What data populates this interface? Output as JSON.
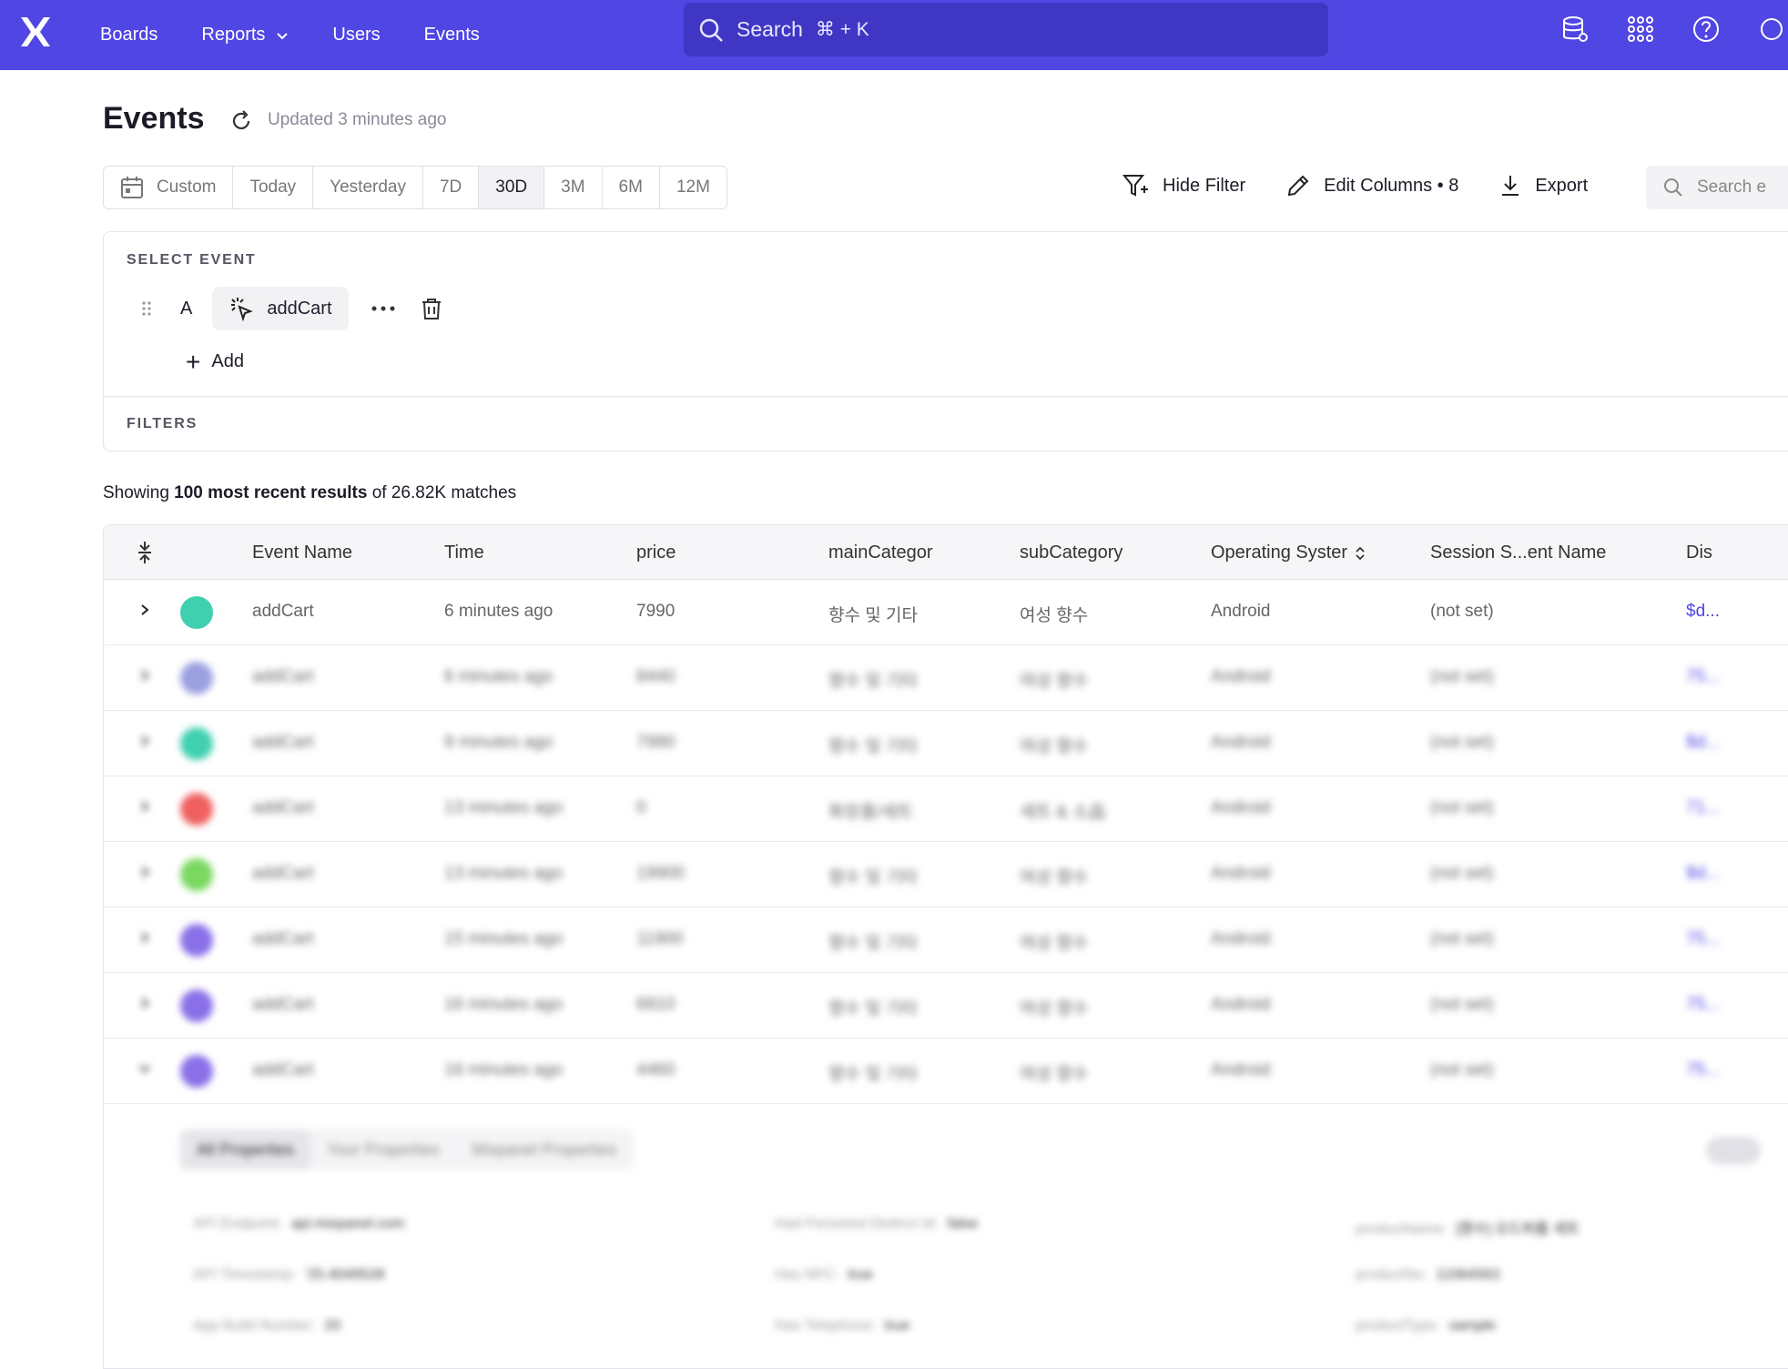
{
  "nav": {
    "links": [
      "Boards",
      "Reports",
      "Users",
      "Events"
    ],
    "search_label": "Search",
    "search_shortcut": "⌘ + K",
    "brand_color": "#5046e4"
  },
  "header": {
    "title": "Events",
    "updated": "Updated 3 minutes ago"
  },
  "date_range": {
    "options": [
      "Custom",
      "Today",
      "Yesterday",
      "7D",
      "30D",
      "3M",
      "6M",
      "12M"
    ],
    "selected": "30D"
  },
  "actions": {
    "hide_filter": "Hide Filter",
    "edit_columns": "Edit Columns • 8",
    "export": "Export",
    "search_placeholder": "Search e"
  },
  "select_event": {
    "label": "SELECT EVENT",
    "letter": "A",
    "event": "addCart",
    "add_label": "Add",
    "filters_label": "FILTERS"
  },
  "results": {
    "prefix": "Showing ",
    "bold": "100 most recent results",
    "suffix": " of 26.82K matches"
  },
  "table": {
    "columns": [
      "Event Name",
      "Time",
      "price",
      "mainCategor",
      "subCategory",
      "Operating Syster",
      "Session S...ent Name",
      "Dis"
    ],
    "rows": [
      {
        "event": "addCart",
        "time": "6 minutes ago",
        "price": "7990",
        "main": "향수 및 기타",
        "sub": "여성 향수",
        "os": "Android",
        "session": "(not set)",
        "dist": "$d...",
        "color": "#3fd0b0"
      },
      {
        "event": "addCart",
        "time": "6 minutes ago",
        "price": "8440",
        "main": "향수 및 기타",
        "sub": "여성 향수",
        "os": "Android",
        "session": "(not set)",
        "dist": "75...",
        "color": "#9aa0e0"
      },
      {
        "event": "addCart",
        "time": "9 minutes ago",
        "price": "7990",
        "main": "향수 및 기타",
        "sub": "여성 향수",
        "os": "Android",
        "session": "(not set)",
        "dist": "$d...",
        "color": "#3fd0b0"
      },
      {
        "event": "addCart",
        "time": "13 minutes ago",
        "price": "0",
        "main": "화장품/세트",
        "sub": "세트 & 소品",
        "os": "Android",
        "session": "(not set)",
        "dist": "71...",
        "color": "#f06060"
      },
      {
        "event": "addCart",
        "time": "13 minutes ago",
        "price": "19900",
        "main": "향수 및 기타",
        "sub": "여성 향수",
        "os": "Android",
        "session": "(not set)",
        "dist": "$d...",
        "color": "#7ad860"
      },
      {
        "event": "addCart",
        "time": "15 minutes ago",
        "price": "11900",
        "main": "향수 및 기타",
        "sub": "여성 향수",
        "os": "Android",
        "session": "(not set)",
        "dist": "75...",
        "color": "#8a70e8"
      },
      {
        "event": "addCart",
        "time": "16 minutes ago",
        "price": "6810",
        "main": "향수 및 기타",
        "sub": "여성 향수",
        "os": "Android",
        "session": "(not set)",
        "dist": "75...",
        "color": "#8a70e8"
      },
      {
        "event": "addCart",
        "time": "16 minutes ago",
        "price": "4460",
        "main": "향수 및 기타",
        "sub": "여성 향수",
        "os": "Android",
        "session": "(not set)",
        "dist": "75...",
        "color": "#8a70e8"
      }
    ]
  },
  "details": {
    "tabs": [
      "All Properties",
      "Your Properties",
      "Mixpanel Properties"
    ],
    "props": [
      {
        "k": "API Endpoint:",
        "v": "api.mixpanel.com",
        "link": true
      },
      {
        "k": "API Timestamp:",
        "v": "'25.4049528"
      },
      {
        "k": "App Build Number:",
        "v": "20"
      },
      {
        "k": "Had Persisted Distinct Id:",
        "v": "false"
      },
      {
        "k": "Has NFC:",
        "v": "true"
      },
      {
        "k": "Has Telephone:",
        "v": "true"
      },
      {
        "k": "productName:",
        "v": "[향수] 오드퍼퓸 세트"
      },
      {
        "k": "productNo:",
        "v": "11064563"
      },
      {
        "k": "productType:",
        "v": "sample"
      }
    ]
  }
}
